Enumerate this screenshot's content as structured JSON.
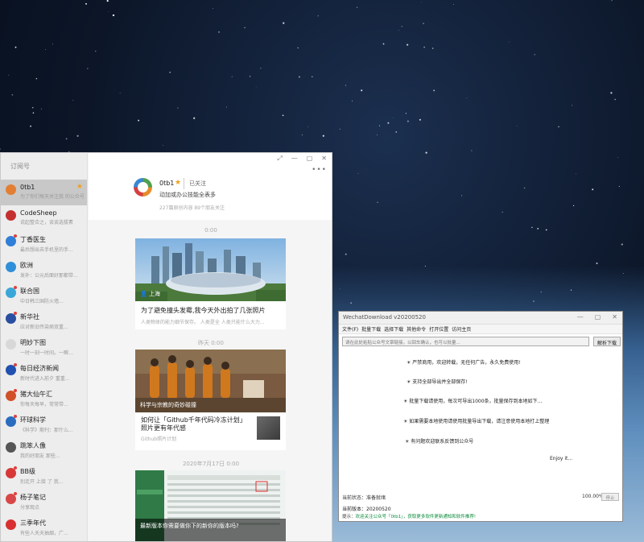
{
  "wechat": {
    "sidebar_title": "订阅号",
    "accounts": [
      {
        "name": "0tb1",
        "desc": "为了你们每天关注我 的公众号...",
        "color": "#e27f33",
        "starred": true,
        "unread": false
      },
      {
        "name": "CodeSheep",
        "desc": "说起整合之，谈谈选拔素",
        "color": "#c43030",
        "starred": false,
        "unread": false
      },
      {
        "name": "丁香医生",
        "desc": "最后想出去手机里的手...",
        "color": "#2f7ed8",
        "starred": false,
        "unread": true
      },
      {
        "name": "欧洲",
        "desc": "发补：公元后面好那都带...",
        "color": "#2f8fd8",
        "starred": false,
        "unread": false
      },
      {
        "name": "联合国",
        "desc": "中日韩三国防火墙...",
        "color": "#3aa7d8",
        "starred": false,
        "unread": true
      },
      {
        "name": "新华社",
        "desc": "应对新旧传染病双重...",
        "color": "#2a4fa0",
        "starred": false,
        "unread": true
      },
      {
        "name": "明妙下图",
        "desc": "一时一刻一时间。一瞬...",
        "color": "#d8d8d8",
        "starred": false,
        "unread": false
      },
      {
        "name": "每日经济新闻",
        "desc": "新时代进入前夕 重重...",
        "color": "#2050b0",
        "starred": false,
        "unread": true
      },
      {
        "name": "猪大仙午汇",
        "desc": "你每天每早，常常带...",
        "color": "#d05028",
        "starred": false,
        "unread": true
      },
      {
        "name": "环球科学",
        "desc": "《科学》期刊：那什么...",
        "color": "#2a6cc0",
        "starred": false,
        "unread": true
      },
      {
        "name": "跳笨人像",
        "desc": "我的好朋友 那些...",
        "color": "#555555",
        "starred": false,
        "unread": false
      },
      {
        "name": "BB级",
        "desc": "别走开 上接 了 我...",
        "color": "#d83838",
        "starred": false,
        "unread": true
      },
      {
        "name": "杨子笔记",
        "desc": "分享观点",
        "color": "#d84848",
        "starred": false,
        "unread": true
      },
      {
        "name": "三季年代",
        "desc": "有些人天天抽烟，广...",
        "color": "#d83030",
        "starred": false,
        "unread": false
      }
    ],
    "header": {
      "name": "0tb1",
      "follow_label": "已关注",
      "subtitle": "动加或办公技能全表多",
      "stats": "227篇原创内容  89个朋友关注"
    },
    "window_buttons": [
      "⤢",
      "—",
      "▢",
      "✕"
    ],
    "more_label": "•••",
    "feed": [
      {
        "time": "0:00",
        "title": "为了避免撞头发霉,我今天外出拍了几张照片",
        "desc": "人类物体的能力细节保存。 人类是全 人类只能什么大力...",
        "caption": "",
        "subs": []
      },
      {
        "time": "昨天 0:00",
        "title": "",
        "desc": "",
        "caption": "科学与宗教的奇妙碰撞",
        "subs": [
          {
            "title": "如何让「Github千年代码冷冻计划」照片更有年代感",
            "meta": "Github照片计划"
          }
        ]
      },
      {
        "time": "2020年7月17日 0:00",
        "title": "",
        "desc": "",
        "caption": "最新版本你需要做你下的新你的版本吗?",
        "subs": []
      }
    ]
  },
  "downloader": {
    "title": "WechatDownload v20200520",
    "window_buttons": [
      "—",
      "▢",
      "✕"
    ],
    "menu": [
      "文件(F)",
      "批量下载",
      "选择下载",
      "其他命令",
      "打开位置",
      "访问主页"
    ],
    "url_placeholder": "请在此处粘贴公众号文章链接，以回车确认，也可以批量...",
    "download_button": "解析下载",
    "log": [
      "☀ 严禁商用，欢迎转载，无任何广告，永久免费使用!",
      "☀ 支持全部导出并全部保存!",
      "☀ 批量下载请使用，每次可导出1000条，批量保存到本地如下...",
      "☀ 如果需要本地使用请使用批量导出下载，请注意使用本地打上整理",
      "☀ 有问题欢迎联系反馈到公众号"
    ],
    "enjoy_text": "Enjoy it...",
    "status": "当前状态：准备就绪",
    "progress_pct": "100.00%",
    "stop_button": "停止",
    "version_label": "当前版本：20200520",
    "tip_prefix": "提示：",
    "tip_link": "欢迎关注公众号「0tb1」，获取更多软件更新通知和软件推荐!"
  }
}
